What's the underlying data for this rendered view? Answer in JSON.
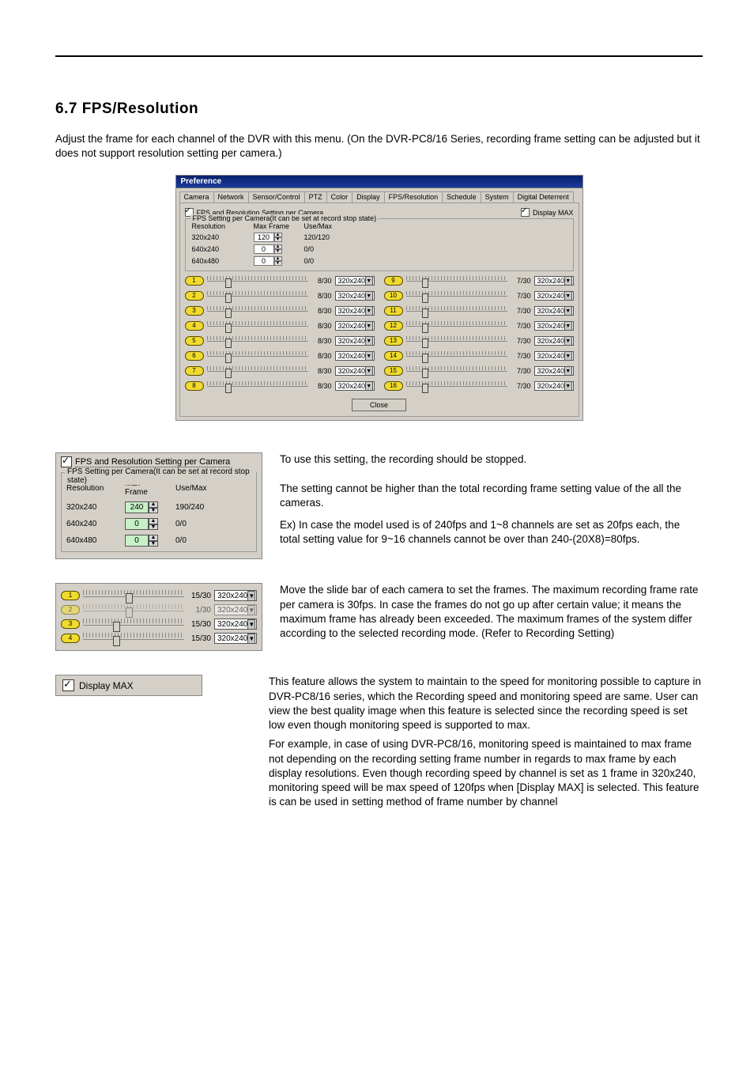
{
  "heading": "6.7    FPS/Resolution",
  "intro": "Adjust the frame for each channel of the DVR with this menu. (On the DVR-PC8/16 Series, recording frame setting can be adjusted but it does not support resolution setting per camera.)",
  "dlg": {
    "title": "Preference",
    "tabs": [
      "Camera",
      "Network",
      "Sensor/Control",
      "PTZ",
      "Color",
      "Display",
      "FPS/Resolution",
      "Schedule",
      "System",
      "Digital Deterrent"
    ],
    "active_tab": "FPS/Resolution",
    "chk_main": "FPS and Resolution Setting per Camera",
    "chk_display_max": "Display MAX",
    "fieldset_legend": "FPS Setting per Camera(It can be set at record stop state)",
    "col_resolution": "Resolution",
    "col_maxframe": "Max Frame",
    "col_usemax": "Use/Max",
    "rows": [
      {
        "res": "320x240",
        "max": "120",
        "use": "120/120"
      },
      {
        "res": "640x240",
        "max": "0",
        "use": "0/0"
      },
      {
        "res": "640x480",
        "max": "0",
        "use": "0/0"
      }
    ],
    "channels_left": [
      {
        "n": "1",
        "fps": "8/30",
        "res": "320x240",
        "thumb": 18
      },
      {
        "n": "2",
        "fps": "8/30",
        "res": "320x240",
        "thumb": 18
      },
      {
        "n": "3",
        "fps": "8/30",
        "res": "320x240",
        "thumb": 18
      },
      {
        "n": "4",
        "fps": "8/30",
        "res": "320x240",
        "thumb": 18
      },
      {
        "n": "5",
        "fps": "8/30",
        "res": "320x240",
        "thumb": 18
      },
      {
        "n": "6",
        "fps": "8/30",
        "res": "320x240",
        "thumb": 18
      },
      {
        "n": "7",
        "fps": "8/30",
        "res": "320x240",
        "thumb": 18
      },
      {
        "n": "8",
        "fps": "8/30",
        "res": "320x240",
        "thumb": 18
      }
    ],
    "channels_right": [
      {
        "n": "9",
        "fps": "7/30",
        "res": "320x240",
        "thumb": 16
      },
      {
        "n": "10",
        "fps": "7/30",
        "res": "320x240",
        "thumb": 16
      },
      {
        "n": "11",
        "fps": "7/30",
        "res": "320x240",
        "thumb": 16
      },
      {
        "n": "12",
        "fps": "7/30",
        "res": "320x240",
        "thumb": 16
      },
      {
        "n": "13",
        "fps": "7/30",
        "res": "320x240",
        "thumb": 16
      },
      {
        "n": "14",
        "fps": "7/30",
        "res": "320x240",
        "thumb": 16
      },
      {
        "n": "15",
        "fps": "7/30",
        "res": "320x240",
        "thumb": 16
      },
      {
        "n": "16",
        "fps": "7/30",
        "res": "320x240",
        "thumb": 16
      }
    ],
    "close": "Close"
  },
  "fig2": {
    "chk": "FPS and Resolution Setting per Camera",
    "legend": "FPS Setting per Camera(It can be set at record stop state)",
    "col_resolution": "Resolution",
    "col_maxframe": "Max Frame",
    "col_usemax": "Use/Max",
    "rows": [
      {
        "res": "320x240",
        "max": "240",
        "use": "190/240",
        "green": true
      },
      {
        "res": "640x240",
        "max": "0",
        "use": "0/0",
        "green": true
      },
      {
        "res": "640x480",
        "max": "0",
        "use": "0/0",
        "green": true
      }
    ]
  },
  "fig2_text1": "To use this setting, the recording should be stopped.",
  "fig2_text2": "The setting cannot be higher than the total recording frame setting value of the all the cameras.",
  "fig2_text3": "Ex) In case the model used is of 240fps and 1~8 channels are set as 20fps each, the total setting value for 9~16 channels cannot be over than 240-(20X8)=80fps.",
  "fig3": {
    "rows": [
      {
        "n": "1",
        "fps": "15/30",
        "res": "320x240",
        "thumb": 42,
        "dim": false
      },
      {
        "n": "2",
        "fps": "1/30",
        "res": "320x240",
        "thumb": 42,
        "dim": true
      },
      {
        "n": "3",
        "fps": "15/30",
        "res": "320x240",
        "thumb": 30,
        "dim": false
      },
      {
        "n": "4",
        "fps": "15/30",
        "res": "320x240",
        "thumb": 30,
        "dim": false
      }
    ]
  },
  "fig3_text": "Move the slide bar of each camera to set the frames. The maximum recording frame rate per camera is 30fps. In case the frames do not go up after certain value; it means the maximum frame has already been exceeded. The maximum frames of the system differ according to the selected recording mode. (Refer to Recording Setting)",
  "fig4": {
    "label": "Display MAX"
  },
  "fig4_text1": "This feature allows the system to maintain to the speed for monitoring possible to capture in DVR-PC8/16 series, which the Recording speed and monitoring speed are same. User can view the best quality image when this feature is selected since the recording speed is set low even though monitoring speed is supported to max.",
  "fig4_text2": "For example, in case of using DVR-PC8/16, monitoring speed is maintained to max frame not depending on the recording setting frame number in regards to max frame by each display resolutions. Even though recording speed by channel is set as 1 frame in 320x240, monitoring speed will be max speed of 120fps when [Display MAX] is selected. This feature is can be used in setting method of frame number by channel"
}
